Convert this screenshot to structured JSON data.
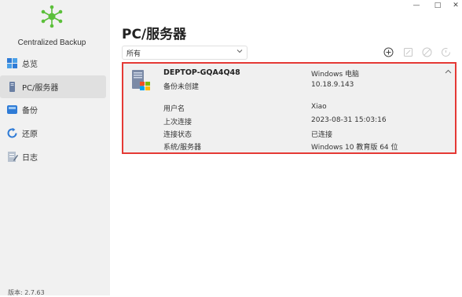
{
  "app": {
    "name": "Centralized Backup",
    "version": "版本: 2.7.63"
  },
  "sidebar": {
    "items": [
      {
        "label": "总览",
        "icon": "overview-grid-icon"
      },
      {
        "label": "PC/服务器",
        "icon": "pc-server-icon"
      },
      {
        "label": "备份",
        "icon": "backup-icon"
      },
      {
        "label": "还原",
        "icon": "restore-icon"
      },
      {
        "label": "日志",
        "icon": "log-icon"
      }
    ],
    "active": "PC/服务器"
  },
  "window_controls": [
    "minimize-icon",
    "maximize-icon",
    "close-icon"
  ],
  "main": {
    "title": "PC/服务器",
    "filter": {
      "selected": "所有"
    },
    "toolbar_icons": [
      "add-icon",
      "edit-icon",
      "disable-icon",
      "restore-history-icon"
    ],
    "device": {
      "name": "DEPTOP-GQA4Q48",
      "backup_status": "备份未创建",
      "type": "Windows 电脑",
      "ip": "10.18.9.143",
      "details": [
        {
          "label": "用户名",
          "value": "Xiao"
        },
        {
          "label": "上次连接",
          "value": "2023-08-31 15:03:16"
        },
        {
          "label": "连接状态",
          "value": "已连接"
        },
        {
          "label": "系统/服务器",
          "value": "Windows 10 教育版 64 位"
        }
      ]
    }
  },
  "colors": {
    "highlight_border": "#e53935",
    "accent": "#3cb54a",
    "sidebar_bg": "#f1f1f1"
  }
}
